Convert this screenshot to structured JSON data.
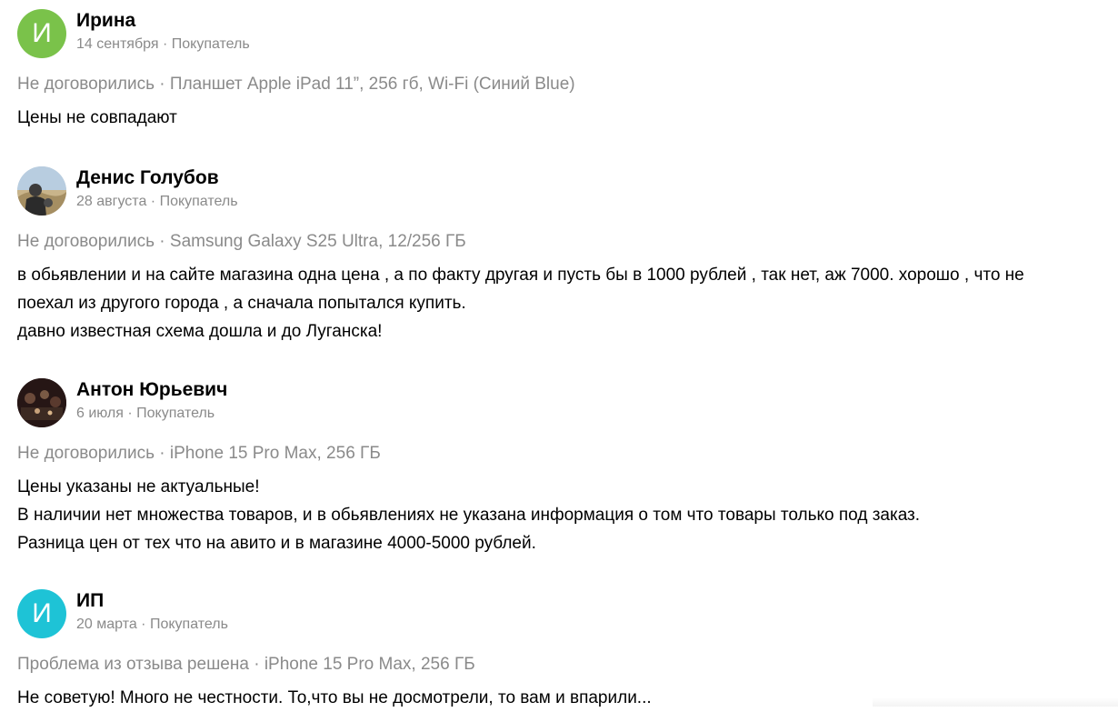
{
  "colors": {
    "avatar_green": "#7ac24a",
    "avatar_cyan": "#1ec3d6",
    "meta_gray": "#8a8a8a"
  },
  "reviews": [
    {
      "avatar_letter": "И",
      "avatar_type": "letter",
      "name": "Ирина",
      "date": "14 сентября",
      "role": "Покупатель",
      "deal": "Не договорились · Планшет Apple iPad 11”, 256 гб, Wi-Fi (Синий Blue)",
      "text": [
        "Цены не совпадают"
      ]
    },
    {
      "avatar_type": "photo",
      "avatar_icon": "user-photo-landscape",
      "name": "Денис Голубов",
      "date": "28 августа",
      "role": "Покупатель",
      "deal": "Не договорились · Samsung Galaxy S25 Ultra, 12/256 ГБ",
      "text": [
        "в обьявлении и на сайте магазина одна цена , а по факту другая и пусть бы в 1000 рублей , так нет, аж 7000. хорошо , что не",
        "поехал из другого города , а сначала попытался купить.",
        "давно известная схема дошла и до Луганска!"
      ]
    },
    {
      "avatar_type": "photo",
      "avatar_icon": "user-photo-dark",
      "name": "Антон Юрьевич",
      "date": "6 июля",
      "role": "Покупатель",
      "deal": "Не договорились · iPhone 15 Pro Max, 256 ГБ",
      "text": [
        "Цены указаны не актуальные!",
        "В наличии нет множества товаров, и в обьявлениях не указана информация о том что товары только под заказ.",
        "Разница цен от тех что на авито и в магазине 4000-5000 рублей."
      ]
    },
    {
      "avatar_letter": "И",
      "avatar_type": "letter",
      "name": "ИП",
      "date": "20 марта",
      "role": "Покупатель",
      "deal": "Проблема из отзыва решена · iPhone 15 Pro Max, 256 ГБ",
      "text": [
        "Не советую! Много не честности. То,что вы не досмотрели, то вам и впарили..."
      ]
    }
  ]
}
